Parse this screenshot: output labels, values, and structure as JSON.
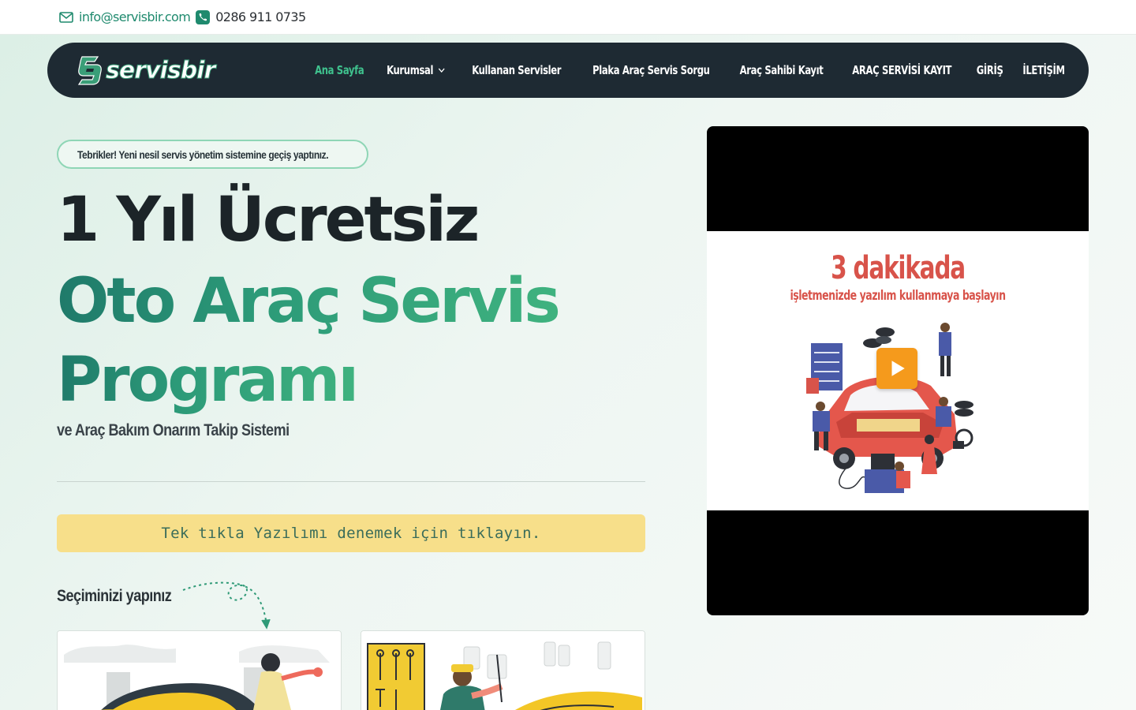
{
  "topbar": {
    "email": "info@servisbir.com",
    "phone": "0286 911 0735"
  },
  "navbar": {
    "logo_text": "servisbir",
    "items": [
      {
        "label": "Ana Sayfa",
        "active": true
      },
      {
        "label": "Kurumsal",
        "has_dropdown": true
      },
      {
        "label": "Kullanan Servisler"
      },
      {
        "label": "Plaka Araç Servis Sorgu"
      },
      {
        "label": "Araç Sahibi Kayıt"
      },
      {
        "label": "ARAÇ SERVİSİ KAYIT"
      },
      {
        "label": "GİRİŞ"
      },
      {
        "label": "İLETİŞİM"
      }
    ]
  },
  "hero": {
    "badge": "Tebrikler! Yeni nesil servis yönetim sistemine geçiş yaptınız.",
    "title_line1": "1 Yıl Ücretsiz",
    "title_line2": "Oto Araç Servis",
    "title_line3": "Programı",
    "subtitle": "ve Araç Bakım Onarım Takip Sistemi",
    "cta": "Tek tıkla Yazılımı denemek için tıklayın.",
    "choose_label": "Seçiminizi yapınız"
  },
  "video": {
    "title": "3 dakikada",
    "subtitle": "işletmenizde yazılım kullanmaya başlayın"
  },
  "colors": {
    "nav_bg": "#1e2a33",
    "accent": "#3fc28e",
    "cta_bg": "#f7df8a",
    "video_text": "#d8534a",
    "play_button": "#f59a1c"
  }
}
